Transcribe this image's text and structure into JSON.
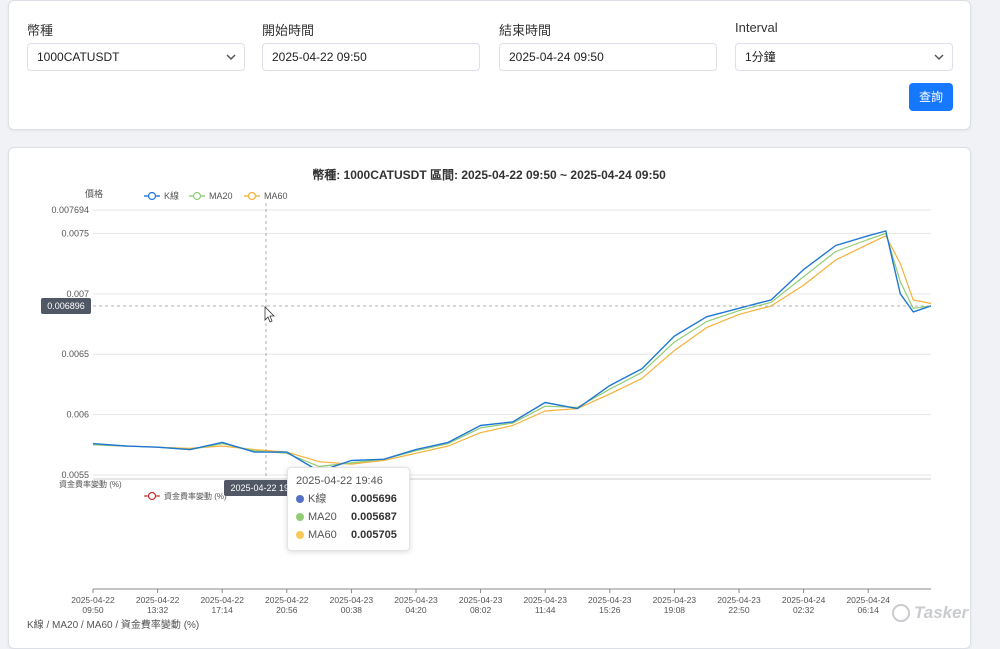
{
  "filters": {
    "coin": {
      "label": "幣種",
      "value": "1000CATUSDT"
    },
    "start": {
      "label": "開始時間",
      "value": "2025-04-22 09:50"
    },
    "end": {
      "label": "結束時間",
      "value": "2025-04-24 09:50"
    },
    "interval": {
      "label": "Interval",
      "value": "1分鐘"
    },
    "query_label": "查詢"
  },
  "colors": {
    "kline": "#1f77d4",
    "ma20": "#91cc75",
    "ma60": "#f4b23a",
    "funding": "#c23531",
    "accent": "#1677ff"
  },
  "chart": {
    "title": "幣種: 1000CATUSDT   區間: 2025-04-22 09:50 ~ 2025-04-24 09:50",
    "price_axis_name": "價格",
    "funding_axis_name": "資金費率變動 (%)",
    "legend": [
      "K線",
      "MA20",
      "MA60"
    ],
    "funding_legend": "資金費率變動 (%)",
    "cursor_y_label": "0.006896",
    "cursor_x_label": "2025-04-22 19:46",
    "bottom_caption": "K線 / MA20 / MA60 / 資金費率變動 (%)"
  },
  "tooltip": {
    "time": "2025-04-22 19:46",
    "rows": [
      {
        "name": "K線",
        "value": "0.005696"
      },
      {
        "name": "MA20",
        "value": "0.005687"
      },
      {
        "name": "MA60",
        "value": "0.005705"
      }
    ]
  },
  "watermark": "Tasker",
  "chart_data": {
    "type": "line",
    "title": "幣種: 1000CATUSDT   區間: 2025-04-22 09:50 ~ 2025-04-24 09:50",
    "ylabel": "價格",
    "ylim": [
      0.0055,
      0.007694
    ],
    "y_ticks": [
      "0.007694",
      "0.0075",
      "0.007",
      "0.0065",
      "0.006",
      "0.0055"
    ],
    "y_tick_values": [
      0.007694,
      0.0075,
      0.007,
      0.0065,
      0.006,
      0.0055
    ],
    "x_ticks": [
      "2025-04-22 09:50",
      "2025-04-22 13:32",
      "2025-04-22 17:14",
      "2025-04-22 20:56",
      "2025-04-23 00:38",
      "2025-04-23 04:20",
      "2025-04-23 08:02",
      "2025-04-23 11:44",
      "2025-04-23 15:26",
      "2025-04-23 19:08",
      "2025-04-23 22:50",
      "2025-04-24 02:32",
      "2025-04-24 06:14"
    ],
    "x": [
      "2025-04-22 09:50",
      "2025-04-22 11:41",
      "2025-04-22 13:32",
      "2025-04-22 15:23",
      "2025-04-22 17:14",
      "2025-04-22 19:05",
      "2025-04-22 20:56",
      "2025-04-22 22:47",
      "2025-04-23 00:38",
      "2025-04-23 02:29",
      "2025-04-23 04:20",
      "2025-04-23 06:11",
      "2025-04-23 08:02",
      "2025-04-23 09:53",
      "2025-04-23 11:44",
      "2025-04-23 13:35",
      "2025-04-23 15:26",
      "2025-04-23 17:17",
      "2025-04-23 19:08",
      "2025-04-23 20:59",
      "2025-04-23 22:50",
      "2025-04-24 00:41",
      "2025-04-24 02:32",
      "2025-04-24 04:23",
      "2025-04-24 06:14",
      "2025-04-24 07:15",
      "2025-04-24 08:05",
      "2025-04-24 08:50",
      "2025-04-24 09:50"
    ],
    "series": [
      {
        "name": "K線",
        "values": [
          0.00576,
          0.00574,
          0.00573,
          0.00571,
          0.00577,
          0.00569,
          0.00569,
          0.00553,
          0.00562,
          0.00563,
          0.00571,
          0.00577,
          0.00591,
          0.00594,
          0.0061,
          0.00605,
          0.00624,
          0.00638,
          0.00665,
          0.00681,
          0.00688,
          0.00695,
          0.0072,
          0.0074,
          0.00748,
          0.00752,
          0.007,
          0.00685,
          0.0069
        ]
      },
      {
        "name": "MA20",
        "values": [
          0.00575,
          0.00574,
          0.00573,
          0.00571,
          0.00576,
          0.0057,
          0.00568,
          0.00557,
          0.0056,
          0.00563,
          0.0057,
          0.00576,
          0.00589,
          0.00593,
          0.00607,
          0.00606,
          0.00621,
          0.00635,
          0.0066,
          0.00677,
          0.00686,
          0.00693,
          0.00714,
          0.00735,
          0.00745,
          0.0075,
          0.0071,
          0.00688,
          0.0069
        ]
      },
      {
        "name": "MA60",
        "values": [
          0.00575,
          0.00574,
          0.00573,
          0.00572,
          0.00574,
          0.00571,
          0.00569,
          0.00561,
          0.00559,
          0.00562,
          0.00568,
          0.00574,
          0.00585,
          0.00591,
          0.00603,
          0.00605,
          0.00617,
          0.0063,
          0.00653,
          0.00672,
          0.00683,
          0.0069,
          0.00707,
          0.00728,
          0.00741,
          0.00748,
          0.00725,
          0.00695,
          0.00692
        ]
      }
    ],
    "grid": true,
    "legend_position": "top-left"
  }
}
